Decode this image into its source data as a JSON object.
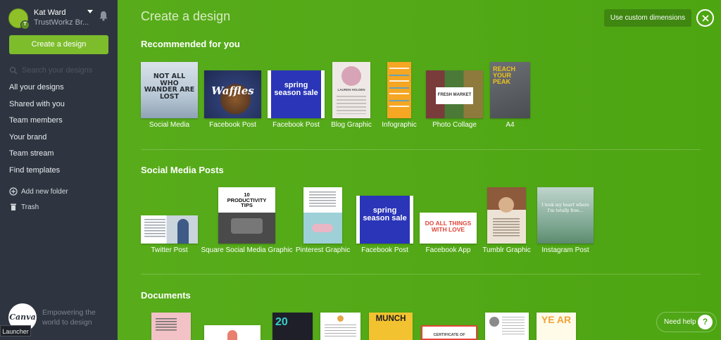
{
  "sidebar": {
    "user_name": "Kat Ward",
    "team_name": "TrustWorkz Br...",
    "avatar_initial": "T",
    "create_label": "Create a design",
    "search_placeholder": "Search your designs",
    "nav": [
      {
        "label": "All your designs"
      },
      {
        "label": "Shared with you"
      },
      {
        "label": "Team members"
      },
      {
        "label": "Your brand"
      },
      {
        "label": "Team stream"
      },
      {
        "label": "Find templates"
      }
    ],
    "add_folder_label": "Add new folder",
    "trash_label": "Trash",
    "logo_text": "Canva",
    "tagline": "Empowering the world to design",
    "launcher_label": "Launcher"
  },
  "header": {
    "title": "Create a design",
    "custom_dimensions_label": "Use custom dimensions"
  },
  "sections": {
    "recommended": {
      "title": "Recommended for you",
      "items": [
        {
          "label": "Social Media",
          "thumb_text": "NOT ALL WHO WANDER ARE LOST"
        },
        {
          "label": "Facebook Post",
          "thumb_text": "Waffles"
        },
        {
          "label": "Facebook Post",
          "thumb_text": "spring season sale"
        },
        {
          "label": "Blog Graphic",
          "thumb_text": "LAUREN HOLDEN"
        },
        {
          "label": "Infographic",
          "thumb_text": ""
        },
        {
          "label": "Photo Collage",
          "thumb_text": "FRESH MARKET"
        },
        {
          "label": "A4",
          "thumb_text": "REACH YOUR PEAK"
        }
      ]
    },
    "social": {
      "title": "Social Media Posts",
      "items": [
        {
          "label": "Twitter Post",
          "thumb_text": ""
        },
        {
          "label": "Square Social Media Graphic",
          "thumb_text": "10 PRODUCTIVITY TIPS"
        },
        {
          "label": "Pinterest Graphic",
          "thumb_text": ""
        },
        {
          "label": "Facebook Post",
          "thumb_text": "spring season sale"
        },
        {
          "label": "Facebook App",
          "thumb_text": "DO ALL THINGS WITH LOVE"
        },
        {
          "label": "Tumblr Graphic",
          "thumb_text": ""
        },
        {
          "label": "Instagram Post",
          "thumb_text": "I took my heart where I'm totally free..."
        }
      ]
    },
    "documents": {
      "title": "Documents",
      "items": [
        {
          "thumb_text": ""
        },
        {
          "thumb_text": ""
        },
        {
          "thumb_text": "20"
        },
        {
          "thumb_text": ""
        },
        {
          "thumb_text": "MUNCH"
        },
        {
          "thumb_text": "CERTIFICATE OF"
        },
        {
          "thumb_text": ""
        },
        {
          "thumb_text": "YE AR"
        }
      ]
    }
  },
  "help": {
    "label": "Need help",
    "icon_text": "?"
  },
  "colors": {
    "sidebar": "#2f3540",
    "accent": "#7dbd2c",
    "main_bg": "#52a816",
    "custom_btn": "#3f8711"
  }
}
